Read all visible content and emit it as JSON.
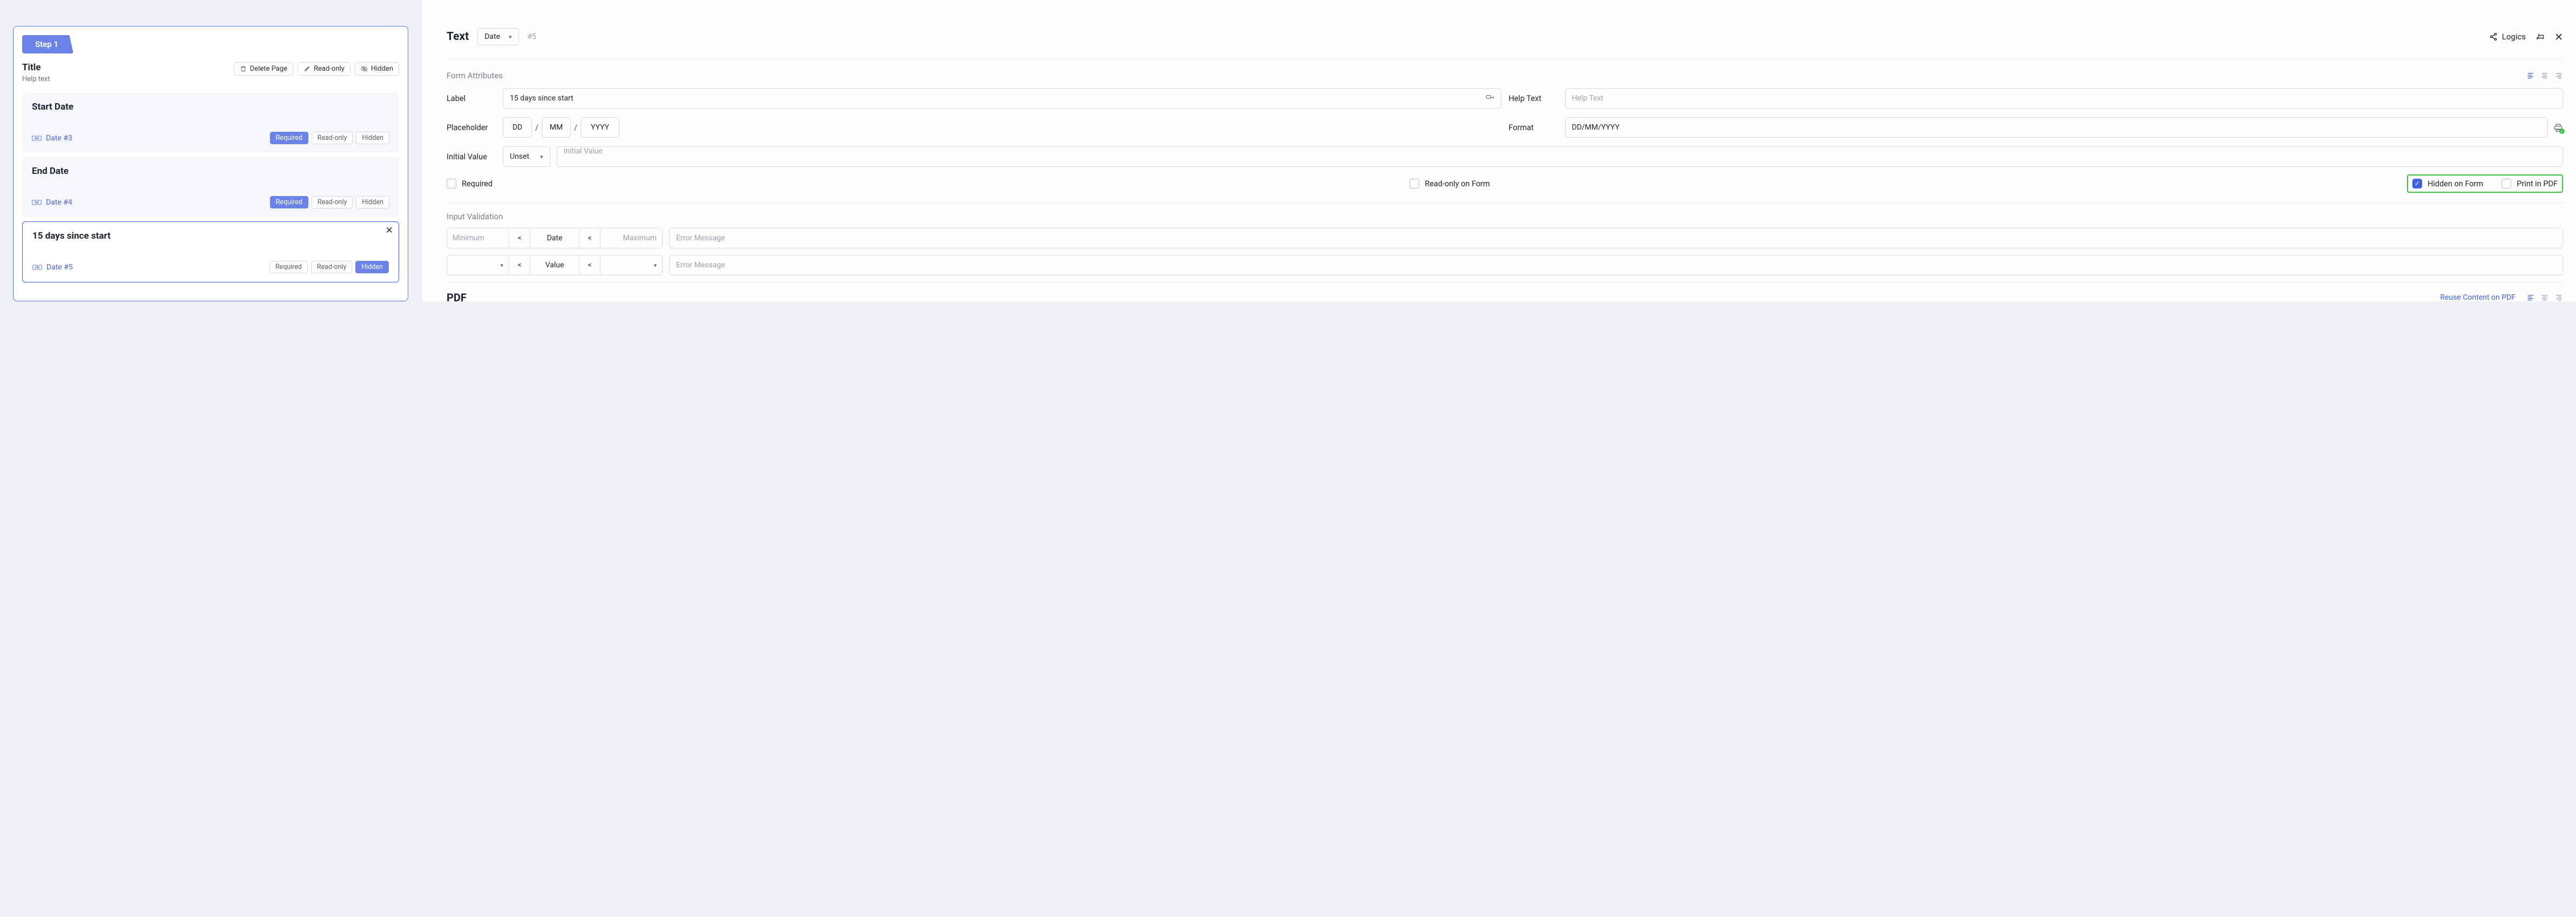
{
  "left": {
    "step_label": "Step 1",
    "title": "Title",
    "help_text": "Help text",
    "toolbar": {
      "delete_page": "Delete Page",
      "read_only": "Read-only",
      "hidden": "Hidden"
    },
    "fields": [
      {
        "label": "Start Date",
        "id_text": "Date #3",
        "tags": {
          "required": "Required",
          "readonly": "Read-only",
          "hidden": "Hidden"
        },
        "required_solid": true,
        "hidden_solid": false,
        "selected": false
      },
      {
        "label": "End Date",
        "id_text": "Date #4",
        "tags": {
          "required": "Required",
          "readonly": "Read-only",
          "hidden": "Hidden"
        },
        "required_solid": true,
        "hidden_solid": false,
        "selected": false
      },
      {
        "label": "15 days since start",
        "id_text": "Date #5",
        "tags": {
          "required": "Required",
          "readonly": "Read-only",
          "hidden": "Hidden"
        },
        "required_solid": false,
        "hidden_solid": true,
        "selected": true
      }
    ]
  },
  "right": {
    "header": {
      "title": "Text",
      "type_select": "Date",
      "id_text": "#5",
      "logics": "Logics"
    },
    "attributes": {
      "section_title": "Form Attributes",
      "label_label": "Label",
      "label_value": "15 days since start",
      "help_label": "Help Text",
      "help_placeholder": "Help Text",
      "placeholder_label": "Placeholder",
      "placeholder_parts": {
        "dd": "DD",
        "mm": "MM",
        "yyyy": "YYYY"
      },
      "format_label": "Format",
      "format_value": "DD/MM/YYYY",
      "initial_label": "Initial Value",
      "initial_select": "Unset",
      "initial_placeholder": "Initial Value"
    },
    "checks": {
      "required": "Required",
      "readonly": "Read-only on Form",
      "hidden": "Hidden on Form",
      "print": "Print in PDF"
    },
    "validation": {
      "section_title": "Input Validation",
      "min": "Minimum",
      "max": "Maximum",
      "date_label": "Date",
      "value_label": "Value",
      "lt": "<",
      "err_placeholder": "Error Message"
    },
    "pdf": {
      "title": "PDF",
      "reuse": "Reuse Content on PDF"
    }
  }
}
